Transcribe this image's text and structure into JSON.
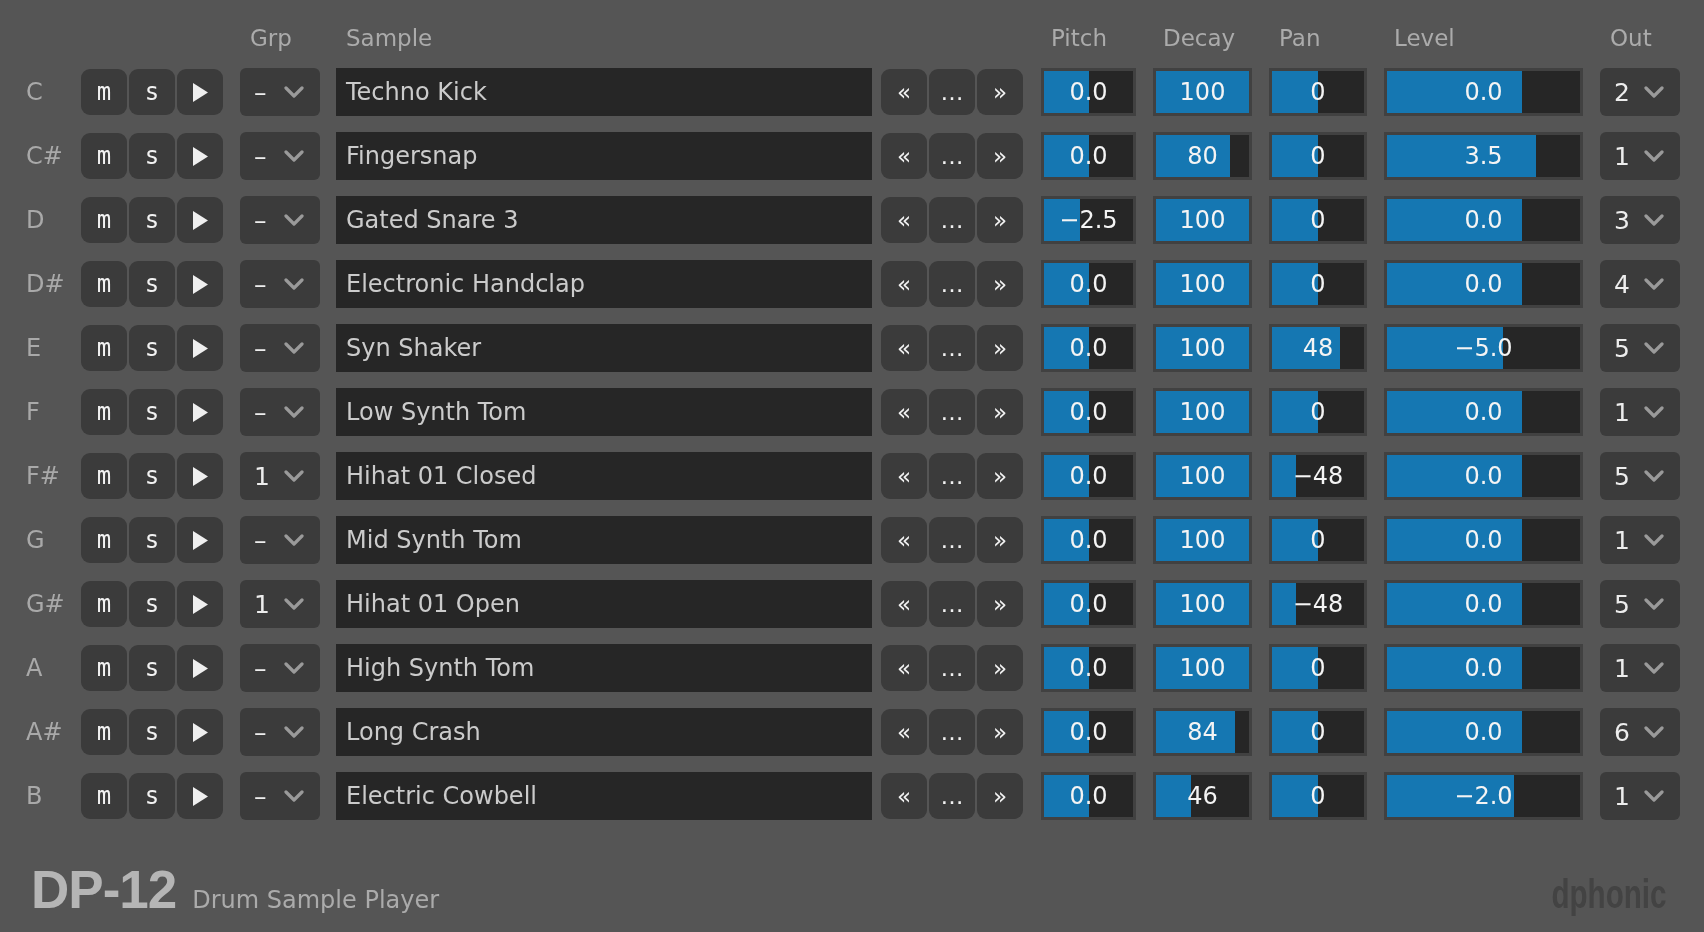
{
  "column_headers": [
    "Grp",
    "Sample",
    "Pitch",
    "Decay",
    "Pan",
    "Level",
    "Out"
  ],
  "rows": [
    {
      "note": "C",
      "mute": "m",
      "solo": "s",
      "group": "–",
      "sample": "Techno Kick",
      "prev": "«",
      "browse": "…",
      "next": "»",
      "pitch_slider": {
        "reading": "0.0",
        "level": 0.5
      },
      "decay_slider": {
        "reading": "100",
        "level": 1
      },
      "pan_slider": {
        "reading": "0",
        "level": 0.5
      },
      "level_slider": {
        "reading": "0.0",
        "level": 0.7
      },
      "output": "2"
    },
    {
      "note": "C#",
      "mute": "m",
      "solo": "s",
      "group": "–",
      "sample": "Fingersnap",
      "prev": "«",
      "browse": "…",
      "next": "»",
      "pitch_slider": {
        "reading": "0.0",
        "level": 0.5
      },
      "decay_slider": {
        "reading": "80",
        "level": 0.8
      },
      "pan_slider": {
        "reading": "0",
        "level": 0.5
      },
      "level_slider": {
        "reading": "3.5",
        "level": 0.77
      },
      "output": "1"
    },
    {
      "note": "D",
      "mute": "m",
      "solo": "s",
      "group": "–",
      "sample": "Gated Snare 3",
      "prev": "«",
      "browse": "…",
      "next": "»",
      "pitch_slider": {
        "reading": "−2.5",
        "level": 0.4
      },
      "decay_slider": {
        "reading": "100",
        "level": 1
      },
      "pan_slider": {
        "reading": "0",
        "level": 0.5
      },
      "level_slider": {
        "reading": "0.0",
        "level": 0.7
      },
      "output": "3"
    },
    {
      "note": "D#",
      "mute": "m",
      "solo": "s",
      "group": "–",
      "sample": "Electronic Handclap",
      "prev": "«",
      "browse": "…",
      "next": "»",
      "pitch_slider": {
        "reading": "0.0",
        "level": 0.5
      },
      "decay_slider": {
        "reading": "100",
        "level": 1
      },
      "pan_slider": {
        "reading": "0",
        "level": 0.5
      },
      "level_slider": {
        "reading": "0.0",
        "level": 0.7
      },
      "output": "4"
    },
    {
      "note": "E",
      "mute": "m",
      "solo": "s",
      "group": "–",
      "sample": "Syn Shaker",
      "prev": "«",
      "browse": "…",
      "next": "»",
      "pitch_slider": {
        "reading": "0.0",
        "level": 0.5
      },
      "decay_slider": {
        "reading": "100",
        "level": 1
      },
      "pan_slider": {
        "reading": "48",
        "level": 0.74
      },
      "level_slider": {
        "reading": "−5.0",
        "level": 0.6
      },
      "output": "5"
    },
    {
      "note": "F",
      "mute": "m",
      "solo": "s",
      "group": "–",
      "sample": "Low Synth Tom",
      "prev": "«",
      "browse": "…",
      "next": "»",
      "pitch_slider": {
        "reading": "0.0",
        "level": 0.5
      },
      "decay_slider": {
        "reading": "100",
        "level": 1
      },
      "pan_slider": {
        "reading": "0",
        "level": 0.5
      },
      "level_slider": {
        "reading": "0.0",
        "level": 0.7
      },
      "output": "1"
    },
    {
      "note": "F#",
      "mute": "m",
      "solo": "s",
      "group": "1",
      "sample": "Hihat 01 Closed",
      "prev": "«",
      "browse": "…",
      "next": "»",
      "pitch_slider": {
        "reading": "0.0",
        "level": 0.5
      },
      "decay_slider": {
        "reading": "100",
        "level": 1
      },
      "pan_slider": {
        "reading": "−48",
        "level": 0.26
      },
      "level_slider": {
        "reading": "0.0",
        "level": 0.7
      },
      "output": "5"
    },
    {
      "note": "G",
      "mute": "m",
      "solo": "s",
      "group": "–",
      "sample": "Mid Synth Tom",
      "prev": "«",
      "browse": "…",
      "next": "»",
      "pitch_slider": {
        "reading": "0.0",
        "level": 0.5
      },
      "decay_slider": {
        "reading": "100",
        "level": 1
      },
      "pan_slider": {
        "reading": "0",
        "level": 0.5
      },
      "level_slider": {
        "reading": "0.0",
        "level": 0.7
      },
      "output": "1"
    },
    {
      "note": "G#",
      "mute": "m",
      "solo": "s",
      "group": "1",
      "sample": "Hihat 01 Open",
      "prev": "«",
      "browse": "…",
      "next": "»",
      "pitch_slider": {
        "reading": "0.0",
        "level": 0.5
      },
      "decay_slider": {
        "reading": "100",
        "level": 1
      },
      "pan_slider": {
        "reading": "−48",
        "level": 0.26
      },
      "level_slider": {
        "reading": "0.0",
        "level": 0.7
      },
      "output": "5"
    },
    {
      "note": "A",
      "mute": "m",
      "solo": "s",
      "group": "–",
      "sample": "High Synth Tom",
      "prev": "«",
      "browse": "…",
      "next": "»",
      "pitch_slider": {
        "reading": "0.0",
        "level": 0.5
      },
      "decay_slider": {
        "reading": "100",
        "level": 1
      },
      "pan_slider": {
        "reading": "0",
        "level": 0.5
      },
      "level_slider": {
        "reading": "0.0",
        "level": 0.7
      },
      "output": "1"
    },
    {
      "note": "A#",
      "mute": "m",
      "solo": "s",
      "group": "–",
      "sample": "Long Crash",
      "prev": "«",
      "browse": "…",
      "next": "»",
      "pitch_slider": {
        "reading": "0.0",
        "level": 0.5
      },
      "decay_slider": {
        "reading": "84",
        "level": 0.85
      },
      "pan_slider": {
        "reading": "0",
        "level": 0.5
      },
      "level_slider": {
        "reading": "0.0",
        "level": 0.7
      },
      "output": "6"
    },
    {
      "note": "B",
      "mute": "m",
      "solo": "s",
      "group": "–",
      "sample": "Electric Cowbell",
      "prev": "«",
      "browse": "…",
      "next": "»",
      "pitch_slider": {
        "reading": "0.0",
        "level": 0.5
      },
      "decay_slider": {
        "reading": "46",
        "level": 0.38
      },
      "pan_slider": {
        "reading": "0",
        "level": 0.5
      },
      "level_slider": {
        "reading": "−2.0",
        "level": 0.66
      },
      "output": "1"
    }
  ],
  "footer": {
    "product": "DP-12",
    "subtitle": "Drum Sample Player",
    "brand": "dphonic"
  }
}
